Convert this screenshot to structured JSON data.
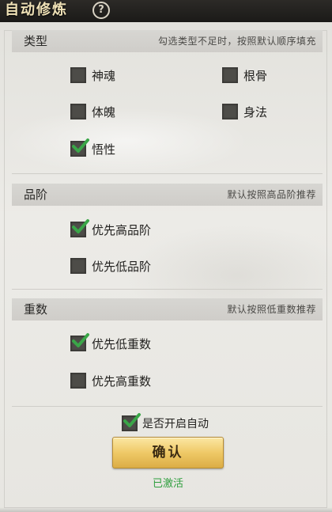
{
  "window": {
    "title": "自动修炼",
    "help_glyph": "?"
  },
  "sections": {
    "type": {
      "title": "类型",
      "hint": "勾选类型不足时，按照默认顺序填充",
      "options": [
        {
          "label": "神魂",
          "checked": false
        },
        {
          "label": "根骨",
          "checked": false
        },
        {
          "label": "体魄",
          "checked": false
        },
        {
          "label": "身法",
          "checked": false
        },
        {
          "label": "悟性",
          "checked": true
        }
      ]
    },
    "grade": {
      "title": "品阶",
      "hint": "默认按照高品阶推荐",
      "options": [
        {
          "label": "优先高品阶",
          "checked": true
        },
        {
          "label": "优先低品阶",
          "checked": false
        }
      ]
    },
    "layers": {
      "title": "重数",
      "hint": "默认按照低重数推荐",
      "options": [
        {
          "label": "优先低重数",
          "checked": true
        },
        {
          "label": "优先高重数",
          "checked": false
        }
      ]
    }
  },
  "auto": {
    "label": "是否开启自动",
    "checked": true
  },
  "confirm_label": "确认",
  "status": "已激活",
  "colors": {
    "check_green": "#3aa648",
    "status_green": "#2f9e3e",
    "button_gold": "#efc967",
    "checkbox_dark": "#4d4c48"
  }
}
